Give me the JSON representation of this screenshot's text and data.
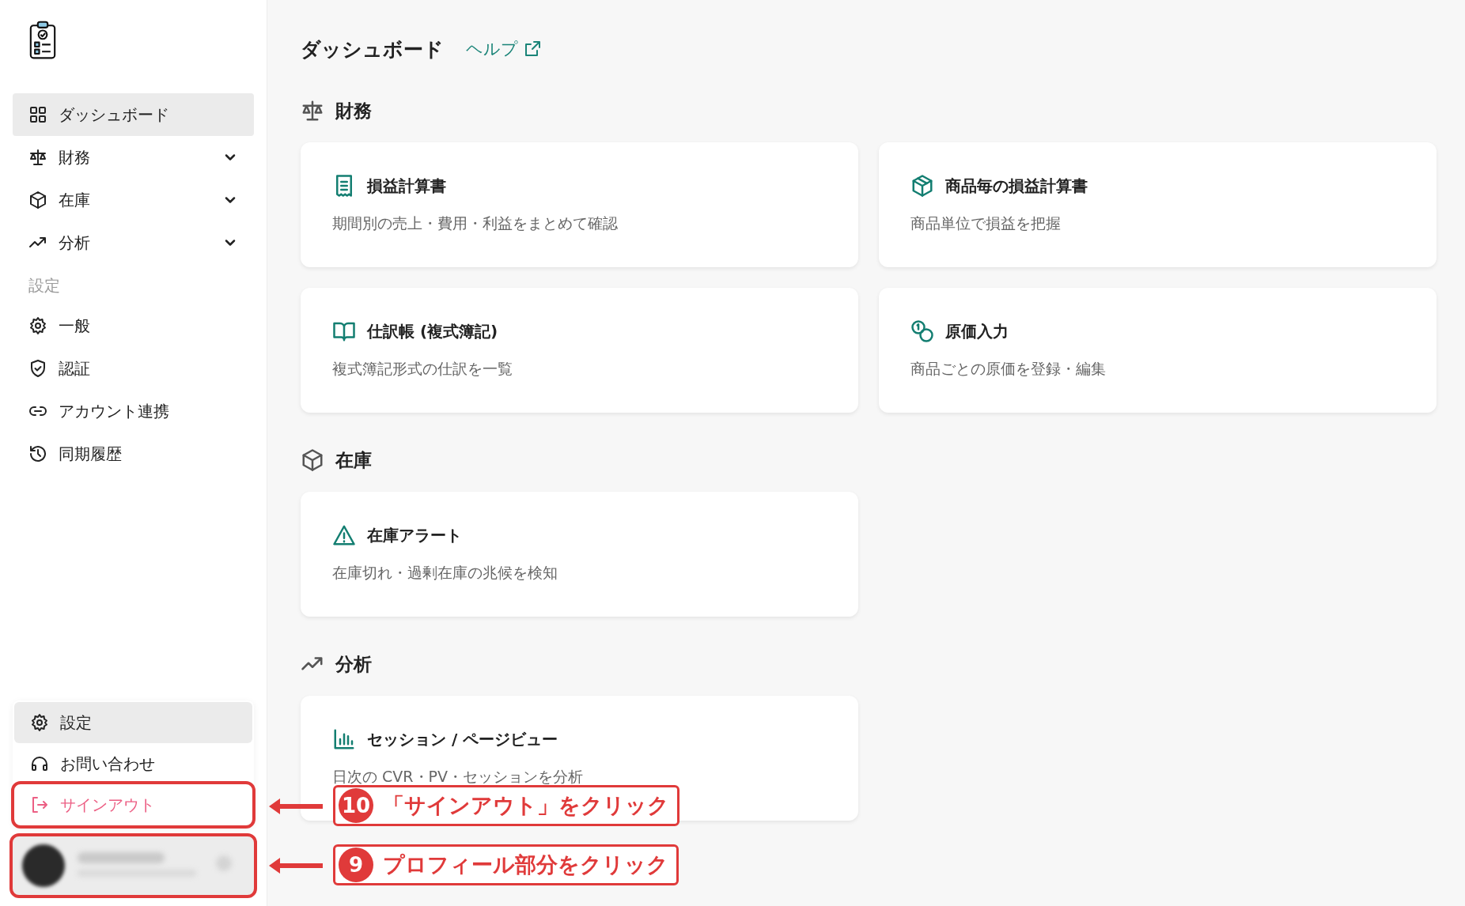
{
  "sidebar": {
    "nav": [
      {
        "label": "ダッシュボード",
        "kind": "link",
        "selected": true
      },
      {
        "label": "財務",
        "kind": "group",
        "selected": false
      },
      {
        "label": "在庫",
        "kind": "group",
        "selected": false
      },
      {
        "label": "分析",
        "kind": "group",
        "selected": false
      }
    ],
    "section_label": "設定",
    "settings": [
      {
        "label": "一般",
        "selected": false
      },
      {
        "label": "認証",
        "selected": false
      },
      {
        "label": "アカウント連携",
        "selected": false
      },
      {
        "label": "同期履歴",
        "selected": false
      }
    ],
    "user_menu": [
      {
        "label": "設定",
        "kind": "normal",
        "selected": true,
        "highlighted": false
      },
      {
        "label": "お問い合わせ",
        "kind": "normal",
        "selected": false,
        "highlighted": false
      },
      {
        "label": "サインアウト",
        "kind": "danger",
        "selected": false,
        "highlighted": true
      }
    ],
    "profile": {
      "highlighted": true
    }
  },
  "main": {
    "title": "ダッシュボード",
    "help": "ヘルプ",
    "sections": [
      {
        "title": "財務",
        "cards": [
          {
            "title": "損益計算書",
            "description": "期間別の売上・費用・利益をまとめて確認"
          },
          {
            "title": "商品毎の損益計算書",
            "description": "商品単位で損益を把握"
          },
          {
            "title": "仕訳帳 (複式簿記)",
            "description": "複式簿記形式の仕訳を一覧"
          },
          {
            "title": "原価入力",
            "description": "商品ごとの原価を登録・編集"
          }
        ]
      },
      {
        "title": "在庫",
        "cards": [
          {
            "title": "在庫アラート",
            "description": "在庫切れ・過剰在庫の兆候を検知"
          }
        ]
      },
      {
        "title": "分析",
        "cards": [
          {
            "title": "セッション / ページビュー",
            "description": "日次の CVR・PV・セッションを分析"
          }
        ]
      }
    ]
  },
  "annotations": [
    {
      "number": "10",
      "text": "「サインアウト」をクリック"
    },
    {
      "number": "9",
      "text": "プロフィール部分をクリック"
    }
  ]
}
